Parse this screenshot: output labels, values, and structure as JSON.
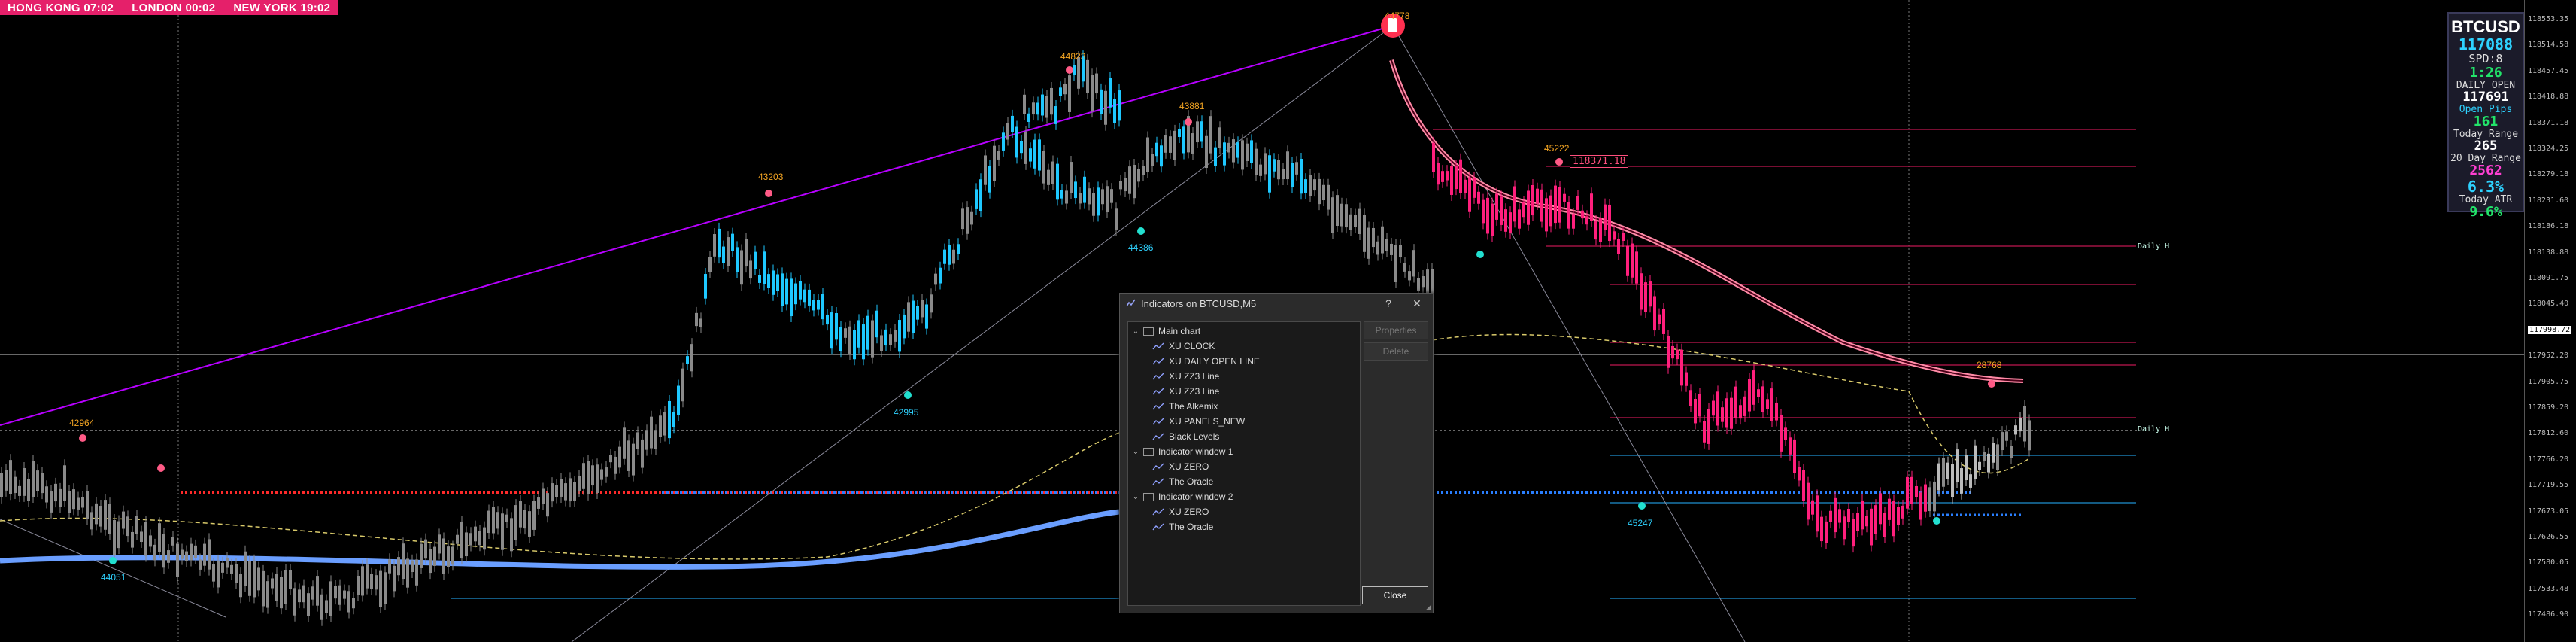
{
  "clock": {
    "items": [
      "HONG KONG 07:02",
      "LONDON  00:02",
      "NEW YORK   19:02"
    ]
  },
  "chart": {
    "swing_labels_orange": [
      "44823",
      "43881",
      "43203",
      "42964",
      "45222",
      "28768",
      "44778"
    ],
    "swing_labels_cyan": [
      "44386",
      "42995",
      "44051",
      "45247"
    ],
    "price_box": "118371.18",
    "right_tags": [
      "Daily H",
      "Daily H"
    ],
    "axis_labels": [
      "118553.35",
      "118514.58",
      "118457.45",
      "118418.88",
      "118371.18",
      "118324.25",
      "118279.18",
      "118231.60",
      "118186.18",
      "118138.88",
      "118091.75",
      "118045.40",
      "117998.72",
      "117952.20",
      "117905.75",
      "117859.20",
      "117812.60",
      "117766.20",
      "117719.55",
      "117673.05",
      "117626.55",
      "117580.05",
      "117533.48",
      "117486.90"
    ],
    "highlight_axis_label": "117998.72",
    "colors": {
      "bull": "#1ec8ff",
      "bear_dn": "#ff1f7c",
      "neutral": "#8a8a8a",
      "trendline": "#b700ff",
      "ema": "#6a9eff",
      "ema_pink": "#ff8aa6"
    }
  },
  "panel": {
    "symbol": "BTCUSD",
    "price": "117088",
    "spread": "SPD:8",
    "time": "1:26",
    "daily_open_label": "DAILY OPEN",
    "daily_open": "117691",
    "open_pips_label": "Open Pips",
    "open_pips": "161",
    "today_range_label": "Today Range",
    "today_range": "265",
    "day20_label": "20 Day Range",
    "day20": "2562",
    "pct1": "6.3%",
    "today_atr_label": "Today ATR",
    "pct2": "9.6%"
  },
  "dialog": {
    "title": "Indicators on BTCUSD,M5",
    "help": "?",
    "close_x": "✕",
    "tree": [
      {
        "label": "Main chart",
        "level": 0,
        "type": "folder"
      },
      {
        "label": "XU CLOCK",
        "level": 1,
        "type": "indicator"
      },
      {
        "label": "XU DAILY OPEN LINE",
        "level": 1,
        "type": "indicator"
      },
      {
        "label": "XU ZZ3 Line",
        "level": 1,
        "type": "indicator"
      },
      {
        "label": "XU ZZ3 Line",
        "level": 1,
        "type": "indicator"
      },
      {
        "label": "The Alkemix",
        "level": 1,
        "type": "indicator"
      },
      {
        "label": "XU PANELS_NEW",
        "level": 1,
        "type": "indicator"
      },
      {
        "label": "Black Levels",
        "level": 1,
        "type": "indicator"
      },
      {
        "label": "Indicator window 1",
        "level": 0,
        "type": "folder"
      },
      {
        "label": "XU ZERO",
        "level": 1,
        "type": "indicator"
      },
      {
        "label": "The Oracle",
        "level": 1,
        "type": "indicator"
      },
      {
        "label": "Indicator window 2",
        "level": 0,
        "type": "folder"
      },
      {
        "label": "XU ZERO",
        "level": 1,
        "type": "indicator"
      },
      {
        "label": "The Oracle",
        "level": 1,
        "type": "indicator"
      }
    ],
    "properties_label": "Properties",
    "delete_label": "Delete",
    "close_label": "Close"
  }
}
